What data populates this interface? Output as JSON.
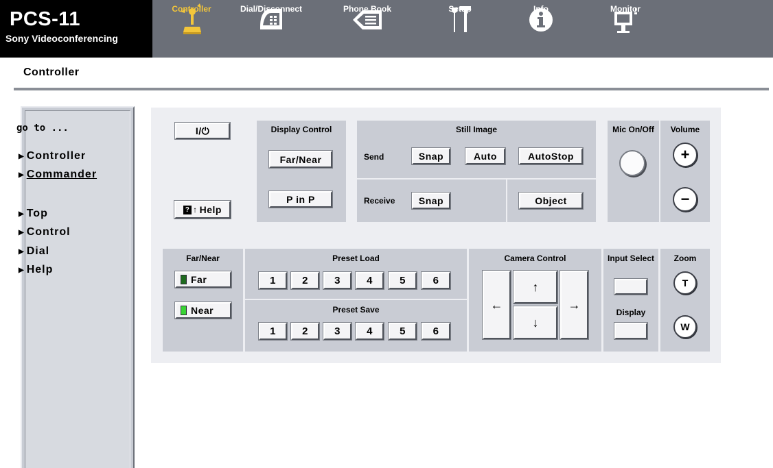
{
  "header": {
    "product": "PCS-11",
    "subtitle": "Sony Videoconferencing",
    "tabs": [
      {
        "label": "Controller",
        "icon": "joystick-icon",
        "active": true
      },
      {
        "label": "Dial/Disconnect",
        "icon": "phone-dial-icon"
      },
      {
        "label": "Phone Book",
        "icon": "phone-book-icon"
      },
      {
        "label": "Setup",
        "icon": "tools-icon"
      },
      {
        "label": "Info",
        "icon": "info-icon"
      },
      {
        "label": "Monitor",
        "icon": "monitor-icon"
      }
    ]
  },
  "page": {
    "title": "Controller"
  },
  "sidebar": {
    "goto": "go to ...",
    "items": [
      "Controller",
      "Commander",
      "Top",
      "Control",
      "Dial",
      "Help"
    ],
    "current": "Commander"
  },
  "controls": {
    "power": "I/⏻",
    "help": "Help",
    "display_control": {
      "title": "Display Control",
      "far_near": "Far/Near",
      "pinp": "P in P"
    },
    "still_image": {
      "title": "Still Image",
      "send": "Send",
      "receive": "Receive",
      "snap": "Snap",
      "auto": "Auto",
      "autostop": "AutoStop",
      "object": "Object"
    },
    "mic": {
      "title": "Mic On/Off"
    },
    "volume": {
      "title": "Volume",
      "plus": "+",
      "minus": "−"
    },
    "far_near": {
      "title": "Far/Near",
      "far": "Far",
      "near": "Near",
      "far_led": "#1f6b1f",
      "near_led": "#39d434"
    },
    "preset_load": {
      "title": "Preset Load",
      "buttons": [
        "1",
        "2",
        "3",
        "4",
        "5",
        "6"
      ]
    },
    "preset_save": {
      "title": "Preset Save",
      "buttons": [
        "1",
        "2",
        "3",
        "4",
        "5",
        "6"
      ]
    },
    "camera_control": {
      "title": "Camera Control",
      "up": "↑",
      "down": "↓",
      "left": "←",
      "right": "→"
    },
    "input_select": {
      "title": "Input Select",
      "display": "Display"
    },
    "zoom": {
      "title": "Zoom",
      "tele": "T",
      "wide": "W"
    }
  }
}
